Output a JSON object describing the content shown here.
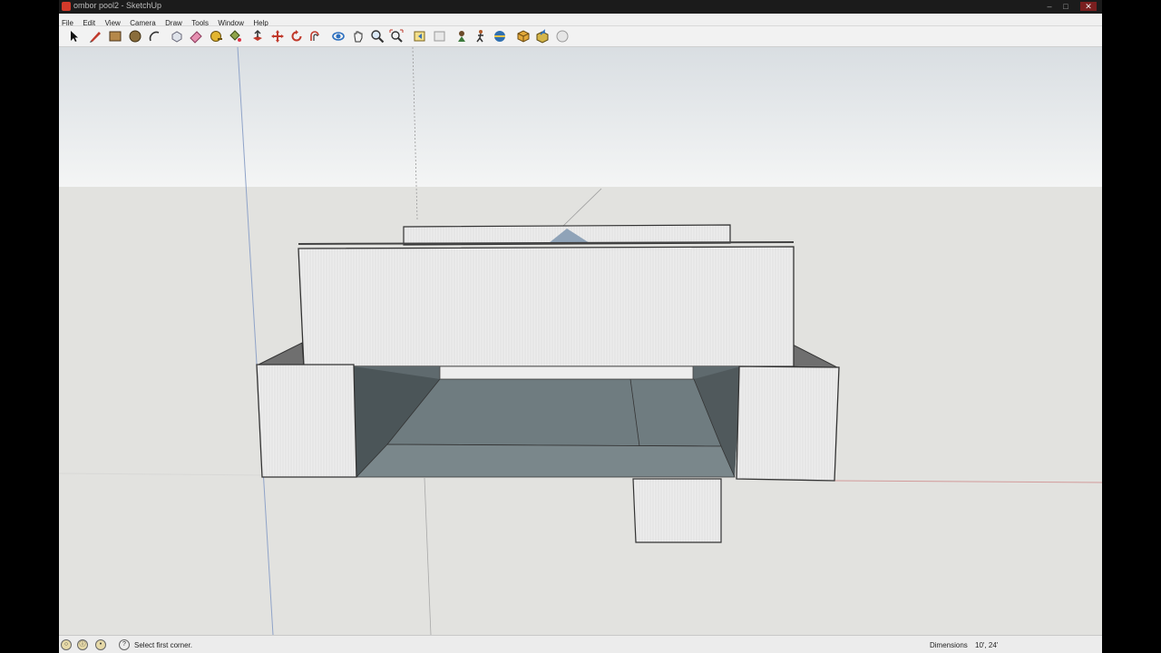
{
  "window": {
    "title": "ombor pool2 - SketchUp"
  },
  "menubar": {
    "items": [
      "File",
      "Edit",
      "View",
      "Camera",
      "Draw",
      "Tools",
      "Window",
      "Help"
    ]
  },
  "toolbar": {
    "tools": [
      "select-icon",
      "pencil-icon",
      "rectangle-icon",
      "circle-icon",
      "arc-icon",
      "make-component-icon",
      "eraser-icon",
      "tape-measure-icon",
      "paint-bucket-icon",
      "push-pull-icon",
      "move-icon",
      "rotate-icon",
      "offset-icon",
      "orbit-icon",
      "pan-icon",
      "zoom-icon",
      "zoom-extents-icon",
      "previous-view-icon",
      "next-view-icon",
      "position-camera-icon",
      "walk-icon",
      "look-around-icon",
      "get-models-icon",
      "share-model-icon",
      "extension-icon"
    ]
  },
  "statusbar": {
    "message": "Select first corner.",
    "dimensions_label": "Dimensions",
    "dimensions_value": "10', 24'"
  }
}
